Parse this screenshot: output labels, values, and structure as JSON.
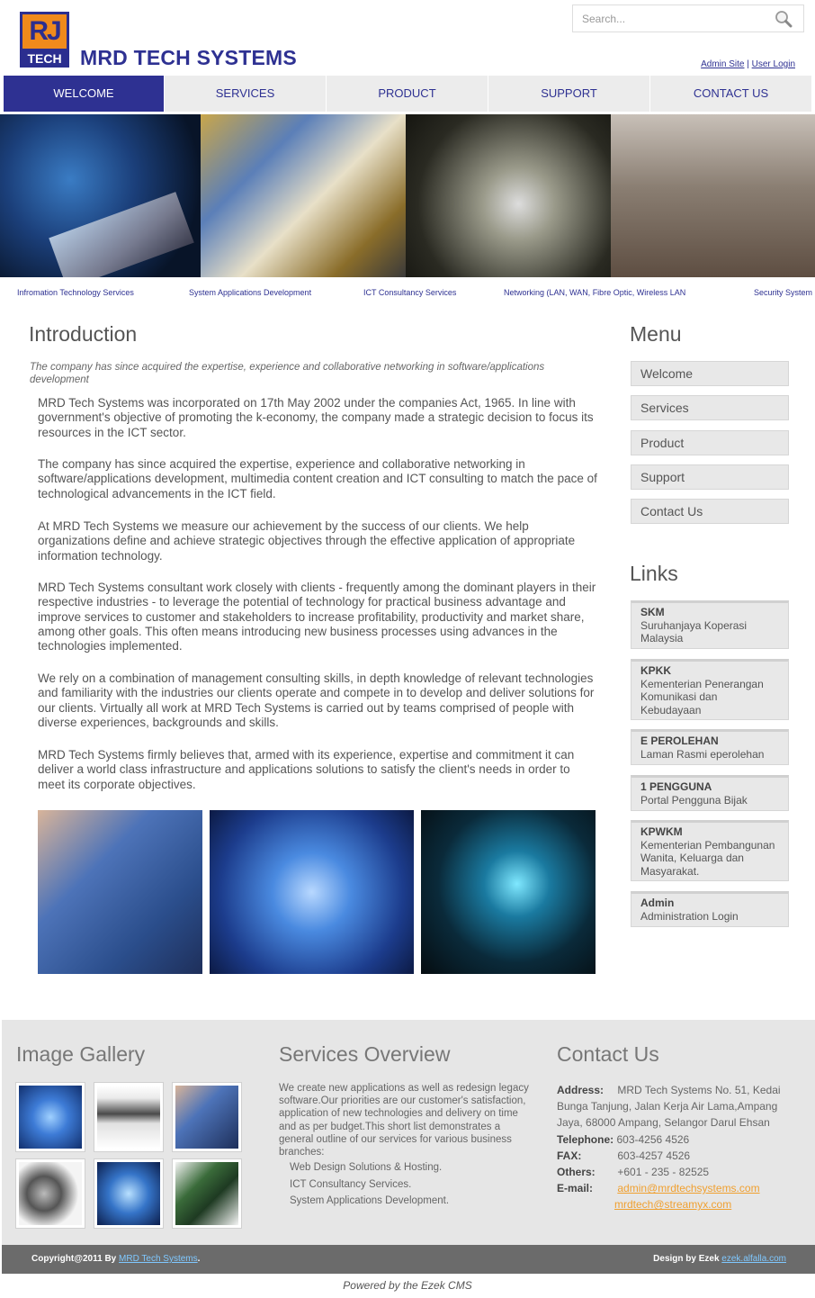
{
  "header": {
    "logo_top": "RJ",
    "logo_bottom": "TECH",
    "site_title": "MRD TECH SYSTEMS",
    "search_placeholder": "Search...",
    "admin_link": "Admin Site",
    "separator": "|",
    "user_link": "User Login"
  },
  "nav": {
    "items": [
      {
        "label": "WELCOME",
        "active": true
      },
      {
        "label": "SERVICES"
      },
      {
        "label": "PRODUCT"
      },
      {
        "label": "SUPPORT"
      },
      {
        "label": "CONTACT US"
      }
    ]
  },
  "banner": {
    "captions": [
      "Infromation Technology Services",
      "System Applications Development",
      "ICT Consultancy Services",
      "Networking (LAN, WAN, Fibre Optic, Wireless LAN",
      "Security System"
    ]
  },
  "main": {
    "heading": "Introduction",
    "subtitle": "The company has since acquired the expertise, experience and collaborative networking in software/applications development",
    "paragraphs": [
      "MRD Tech Systems was incorporated on 17th May 2002 under the companies Act, 1965. In line with government's objective of promoting the k-economy, the company made a strategic decision to focus its resources in the ICT sector.",
      "The company has since acquired the expertise, experience and collaborative networking in software/applications development, multimedia content creation and ICT consulting to match the pace of technological advancements in the ICT field.",
      "At MRD Tech Systems we measure our achievement by the success of our clients. We help organizations define and achieve strategic objectives through the effective application of appropriate information technology.",
      "MRD Tech Systems consultant work closely with clients - frequently among the dominant players in their respective industries - to leverage the potential of technology for practical business advantage and improve services to customer and stakeholders to increase profitability, productivity and market share, among other goals. This often means introducing new business processes using advances in the technologies implemented.",
      "We rely on a combination of management consulting skills, in depth knowledge of relevant technologies and familiarity with the industries our clients operate and compete in to develop and deliver solutions for our clients. Virtually all work at MRD Tech Systems is carried out by teams comprised of people with diverse experiences, backgrounds and skills.",
      "MRD Tech Systems firmly believes that, armed with its experience, expertise and commitment it can deliver a world class infrastructure and applications solutions to satisfy the client's needs in order to meet its corporate objectives."
    ]
  },
  "sidebar": {
    "menu_heading": "Menu",
    "menu_items": [
      "Welcome",
      "Services",
      "Product",
      "Support",
      "Contact Us"
    ],
    "links_heading": "Links",
    "links": [
      {
        "title": "SKM",
        "desc": "Suruhanjaya Koperasi Malaysia"
      },
      {
        "title": "KPKK",
        "desc": "Kementerian Penerangan Komunikasi dan Kebudayaan"
      },
      {
        "title": "E PEROLEHAN",
        "desc": "Laman Rasmi eperolehan"
      },
      {
        "title": "1 PENGGUNA",
        "desc": "Portal Pengguna Bijak"
      },
      {
        "title": "KPWKM",
        "desc": "Kementerian Pembangunan Wanita, Keluarga dan Masyarakat."
      },
      {
        "title": "Admin",
        "desc": "Administration Login"
      }
    ]
  },
  "footer": {
    "gallery_heading": "Image Gallery",
    "services_heading": "Services Overview",
    "services_text": "We create new applications as well as redesign legacy software.Our priorities are our customer's satisfaction, application of new technologies and delivery on time and as per budget.This short list demonstrates a general outline of our services for various business branches:",
    "services_list": [
      "Web Design Solutions & Hosting.",
      "ICT Consultancy Services.",
      "System Applications Development."
    ],
    "contact_heading": "Contact Us",
    "address_label": "Address:",
    "address": "MRD Tech Systems No. 51, Kedai Bunga Tanjung, Jalan Kerja Air Lama,Ampang Jaya, 68000 Ampang, Selangor Darul Ehsan",
    "telephone_label": "Telephone:",
    "telephone": "603-4256 4526",
    "fax_label": "FAX:",
    "fax": "603-4257 4526",
    "others_label": "Others:",
    "others": "+601 - 235 - 82525",
    "email_label": "E-mail:",
    "email1": "admin@mrdtechsystems.com",
    "email2": "mrdtech@streamyx.com",
    "copyright_prefix": "Copyright@2011 By",
    "copyright_link": "MRD Tech Systems",
    "copyright_suffix": ".",
    "design_prefix": "Design by Ezek",
    "design_link": "ezek.alfalla.com",
    "powered_by": "Powered by the Ezek CMS"
  },
  "colors": {
    "brand_blue": "#2e3192",
    "brand_orange": "#f08a1c",
    "link_orange": "#f0a030"
  }
}
